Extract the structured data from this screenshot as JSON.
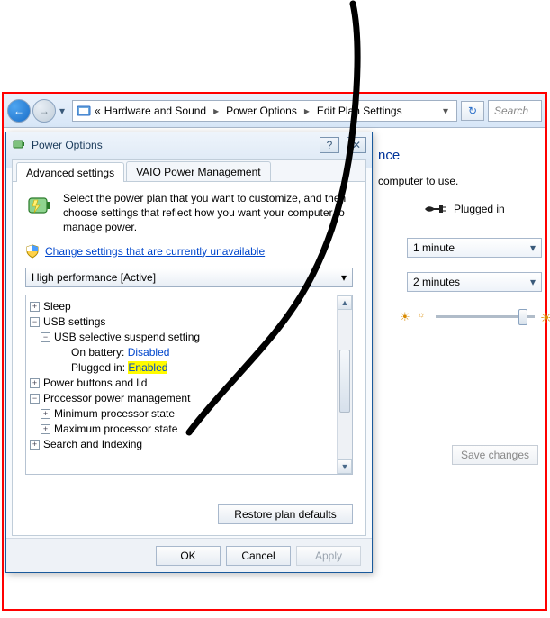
{
  "breadcrumb": {
    "item1": "Hardware and Sound",
    "item2": "Power Options",
    "item3": "Edit Plan Settings"
  },
  "search": {
    "placeholder": "Search"
  },
  "page": {
    "heading_suffix": "nce",
    "desc_suffix": "computer to use.",
    "plugged_label": "Plugged in",
    "dim_value": "1 minute",
    "off_value": "2 minutes",
    "save_changes": "Save changes"
  },
  "dialog": {
    "title": "Power Options",
    "help_glyph": "?",
    "close_glyph": "✕",
    "tab_advanced": "Advanced settings",
    "tab_vaio": "VAIO Power Management",
    "intro": "Select the power plan that you want to customize, and then choose settings that reflect how you want your computer to manage power.",
    "change_link": "Change settings that are currently unavailable",
    "plan_selected": "High performance [Active]",
    "tree": {
      "sleep": "Sleep",
      "usb_settings": "USB settings",
      "usb_suspend": "USB selective suspend setting",
      "on_battery_label": "On battery:",
      "on_battery_value": "Disabled",
      "plugged_in_label": "Plugged in:",
      "plugged_in_value": "Enabled",
      "power_buttons": "Power buttons and lid",
      "proc_power": "Processor power management",
      "min_proc": "Minimum processor state",
      "max_proc": "Maximum processor state",
      "search_indexing": "Search and Indexing"
    },
    "restore": "Restore plan defaults",
    "ok": "OK",
    "cancel": "Cancel",
    "apply": "Apply"
  }
}
